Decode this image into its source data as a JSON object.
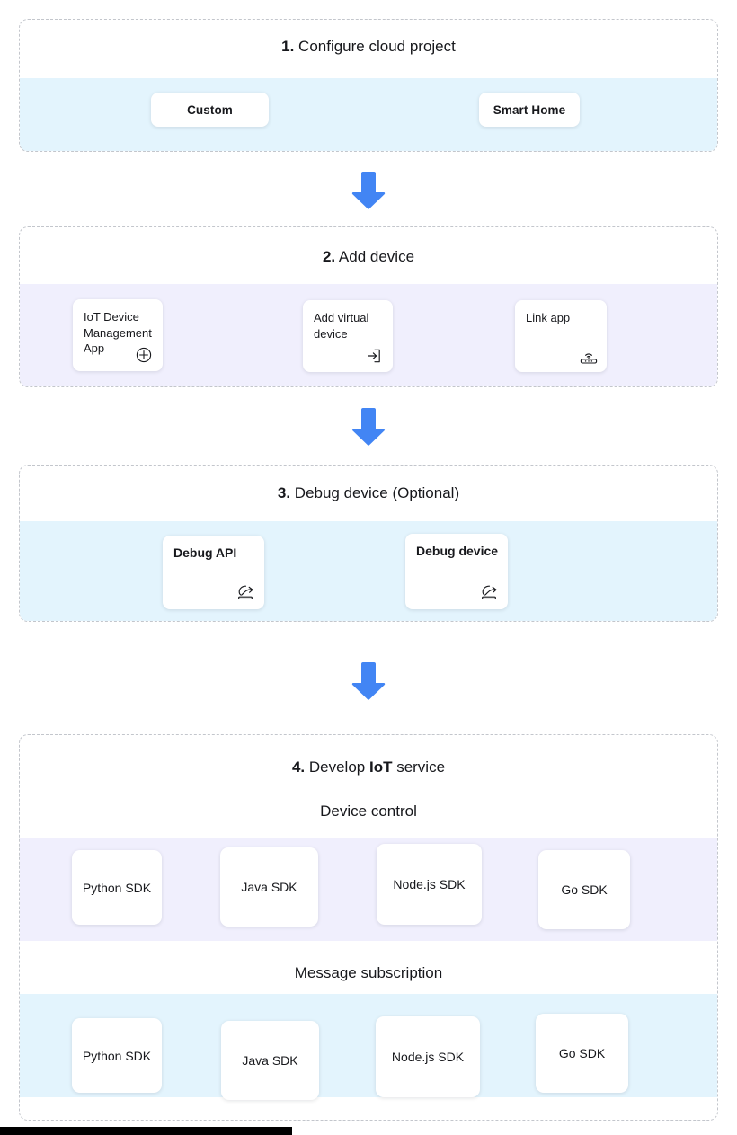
{
  "steps": [
    {
      "number": "1.",
      "title_rest": " Configure cloud project",
      "title_bold_tail": "",
      "band": "blue",
      "options": [
        {
          "label": "Custom"
        },
        {
          "label": "Smart Home"
        }
      ]
    },
    {
      "number": "2.",
      "title_rest": " Add device",
      "band": "lilac",
      "cards": [
        {
          "label": "IoT Device Management App",
          "icon": "plus-circle-icon"
        },
        {
          "label": "Add virtual device",
          "icon": "enter-box-icon"
        },
        {
          "label": "Link app",
          "icon": "gateway-device-icon"
        }
      ]
    },
    {
      "number": "3.",
      "title_rest": " Debug device (Optional)",
      "band": "blue",
      "cards": [
        {
          "label": "Debug API",
          "icon": "debug-share-icon"
        },
        {
          "label": "Debug device",
          "icon": "debug-share-icon"
        }
      ]
    },
    {
      "number": "4.",
      "title_rest": " Develop ",
      "title_bold_word": "IoT",
      "title_tail": " service",
      "groups": [
        {
          "heading": "Device control",
          "band": "lilac",
          "sdks": [
            "Python SDK",
            "Java SDK",
            "Node.js SDK",
            "Go SDK"
          ]
        },
        {
          "heading": "Message subscription",
          "band": "blue",
          "sdks": [
            "Python SDK",
            "Java SDK",
            "Node.js SDK",
            "Go SDK"
          ]
        }
      ]
    }
  ],
  "arrows": [
    {
      "name": "arrow-step1-to-step2"
    },
    {
      "name": "arrow-step2-to-step3"
    },
    {
      "name": "arrow-step3-to-step4"
    }
  ],
  "colors": {
    "arrow_blue": "#4285f4",
    "band_blue": "#e3f4fd",
    "band_lilac": "#f0effd",
    "panel_border": "#c3c6cc",
    "text": "#17181c"
  }
}
